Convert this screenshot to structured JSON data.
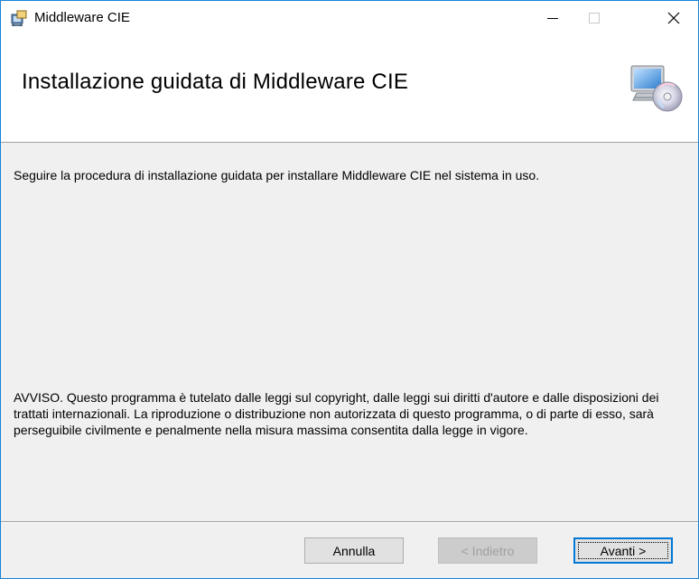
{
  "window": {
    "title": "Middleware CIE",
    "icons": {
      "app": "installer-icon",
      "minimize": "minimize-icon",
      "maximize": "maximize-icon",
      "close": "close-icon"
    }
  },
  "header": {
    "title": "Installazione guidata di Middleware CIE",
    "art_icon": "computer-disc-icon"
  },
  "content": {
    "intro": "Seguire la procedura di installazione guidata per installare Middleware CIE nel sistema in uso.",
    "notice": "AVVISO. Questo programma è tutelato dalle leggi sul copyright, dalle leggi sui diritti d'autore e dalle disposizioni dei trattati internazionali. La riproduzione o distribuzione non autorizzata di questo programma, o di parte di esso, sarà perseguibile civilmente e penalmente nella misura massima consentita dalla legge in vigore."
  },
  "buttons": {
    "cancel": "Annulla",
    "back": "< Indietro",
    "next": "Avanti >"
  },
  "colors": {
    "accent": "#0078d7",
    "window_border": "#1883d7"
  }
}
